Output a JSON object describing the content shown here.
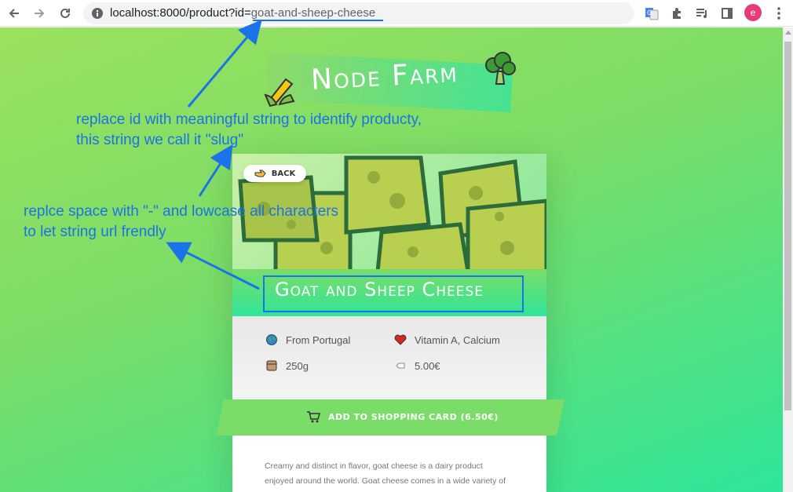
{
  "browser": {
    "url_host": "localhost:8000/product?id=",
    "url_rest": "goat-and-sheep-cheese",
    "avatar_letter": "e"
  },
  "page": {
    "logo": "Node Farm",
    "back_label": "BACK",
    "product_title": "Goat and Sheep Cheese",
    "from": "From Portugal",
    "nutrients": "Vitamin A, Calcium",
    "quantity": "250g",
    "price": "5.00€",
    "buy_label": "ADD TO SHOPPING CARD (6.50€)",
    "description_line1": "Creamy and distinct in flavor, goat cheese is a dairy product",
    "description_line2": "enjoyed around the world. Goat cheese comes in a wide variety of"
  },
  "annotations": {
    "note1_line1": "replace id with meaningful string to identify producty,",
    "note1_line2": "this string we call it \"slug\"",
    "note2_line1": "replce space with \"-\" and lowcase all characters",
    "note2_line2": "to let string url frendly"
  },
  "colors": {
    "accent": "#79dd68",
    "annotation": "#1a73e8",
    "avatar": "#e63b7a"
  }
}
